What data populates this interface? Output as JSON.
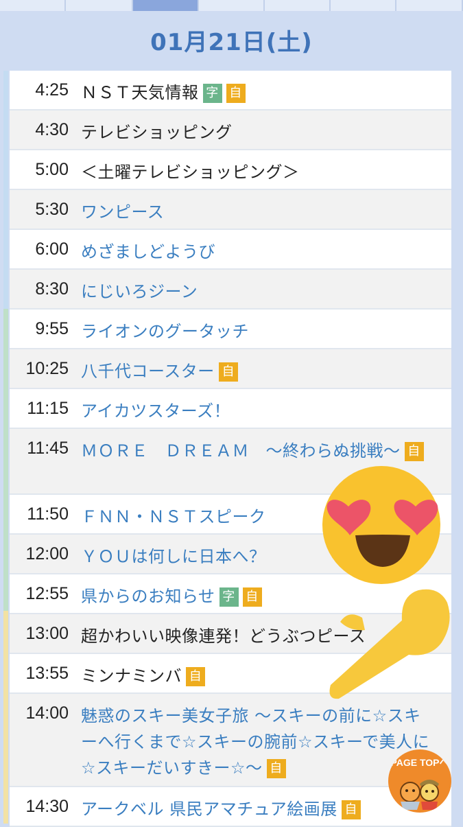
{
  "header": {
    "date": "01月21日(土)"
  },
  "schedule": [
    {
      "time": "4:25",
      "title": "ＮＳＴ天気情報",
      "link": false,
      "bg": "w",
      "badges": [
        "字",
        "自"
      ]
    },
    {
      "time": "4:30",
      "title": "テレビショッピング",
      "link": false,
      "bg": "g",
      "badges": []
    },
    {
      "time": "5:00",
      "title": "＜土曜テレビショッピング＞",
      "link": false,
      "bg": "w",
      "badges": []
    },
    {
      "time": "5:30",
      "title": "ワンピース",
      "link": true,
      "bg": "g",
      "badges": []
    },
    {
      "time": "6:00",
      "title": "めざましどようび",
      "link": true,
      "bg": "w",
      "badges": []
    },
    {
      "time": "8:30",
      "title": "にじいろジーン",
      "link": true,
      "bg": "g",
      "badges": []
    },
    {
      "time": "9:55",
      "title": "ライオンのグータッチ",
      "link": true,
      "bg": "w",
      "badges": []
    },
    {
      "time": "10:25",
      "title": "八千代コースター",
      "link": true,
      "bg": "g",
      "badges": [
        "自"
      ]
    },
    {
      "time": "11:15",
      "title": "アイカツスターズ！",
      "link": true,
      "bg": "w",
      "badges": []
    },
    {
      "time": "11:45",
      "title": "ＭＯＲＥ　ＤＲＥＡＭ　～終わらぬ挑戦～",
      "link": true,
      "bg": "g",
      "badges": [
        "自"
      ]
    },
    {
      "time": "11:50",
      "title": "ＦＮＮ・ＮＳＴスピーク",
      "link": true,
      "bg": "w",
      "badges": []
    },
    {
      "time": "12:00",
      "title": "ＹＯＵは何しに日本へ？",
      "link": true,
      "bg": "g",
      "badges": []
    },
    {
      "time": "12:55",
      "title": "県からのお知らせ",
      "link": true,
      "bg": "w",
      "badges": [
        "字",
        "自"
      ]
    },
    {
      "time": "13:00",
      "title": "超かわいい映像連発！どうぶつピース",
      "link": false,
      "bg": "g",
      "badges": []
    },
    {
      "time": "13:55",
      "title": "ミンナミンバ",
      "link": false,
      "bg": "w",
      "badges": [
        "自"
      ]
    },
    {
      "time": "14:00",
      "title": "魅惑のスキー美女子旅 ～スキーの前に☆スキーへ行くまで☆スキーの腕前☆スキーで美人に☆スキーだいすきー☆～",
      "link": true,
      "bg": "g",
      "badges": [
        "自"
      ]
    },
    {
      "time": "14:30",
      "title": "アークベル 県民アマチュア絵画展",
      "link": true,
      "bg": "w",
      "badges": [
        "自"
      ]
    }
  ],
  "page_top": {
    "label": "PAGE TOPへ"
  },
  "colors": {
    "link": "#3a7ec0",
    "badge_ji": "#6bb58b",
    "badge_auto": "#eeac1e",
    "date": "#3f73b8"
  },
  "icons": [
    "heart-eyes-emoji-icon",
    "pointing-hand-emoji-icon",
    "page-top-icon"
  ]
}
